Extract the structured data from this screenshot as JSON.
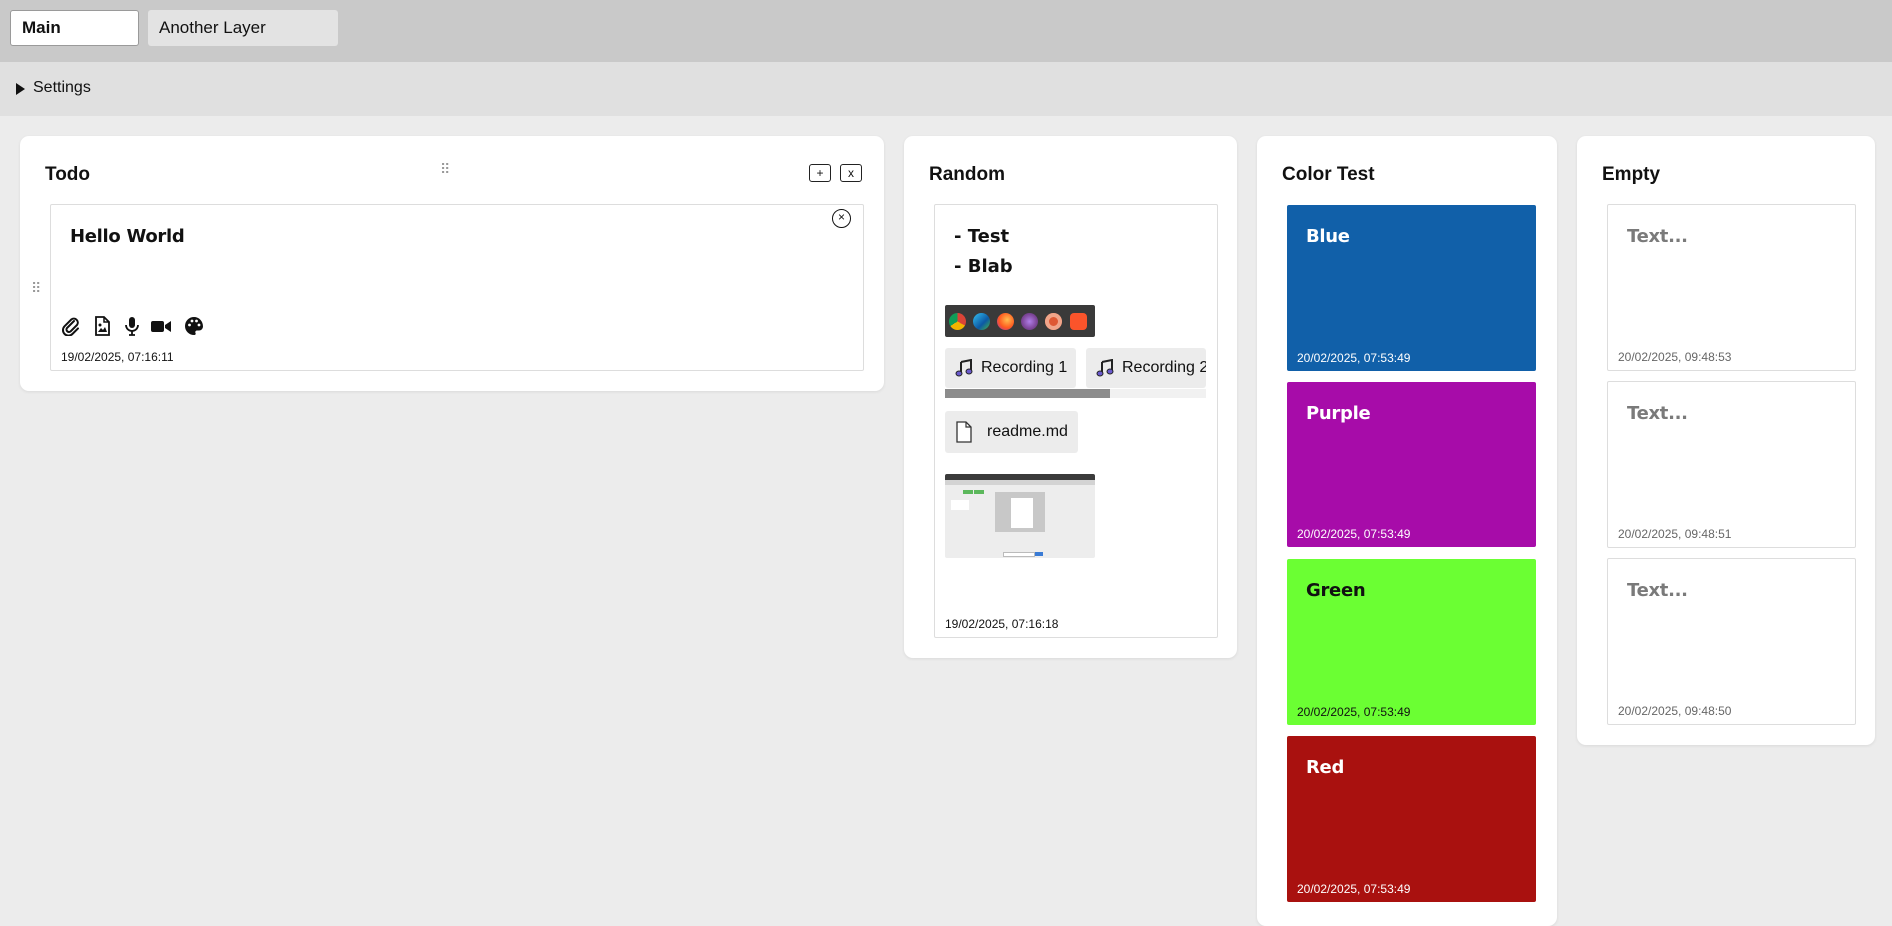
{
  "tabs": {
    "main": "Main",
    "another": "Another Layer"
  },
  "settings": {
    "label": "Settings"
  },
  "columns": {
    "todo": {
      "title": "Todo",
      "add_label": "+",
      "remove_label": "x",
      "note": {
        "title": "Hello World",
        "close_label": "×",
        "date": "19/02/2025, 07:16:11"
      }
    },
    "random": {
      "title": "Random",
      "note": {
        "lines": [
          "- Test",
          "- Blab"
        ],
        "recordings": [
          "Recording 1",
          "Recording 2"
        ],
        "file": "readme.md",
        "date": "19/02/2025, 07:16:18"
      }
    },
    "color_test": {
      "title": "Color Test",
      "notes": [
        {
          "title": "Blue",
          "date": "20/02/2025, 07:53:49",
          "color": "#1160a9"
        },
        {
          "title": "Purple",
          "date": "20/02/2025, 07:53:49",
          "color": "#a70ca9"
        },
        {
          "title": "Green",
          "date": "20/02/2025, 07:53:49",
          "color": "#6bff33"
        },
        {
          "title": "Red",
          "date": "20/02/2025, 07:53:49",
          "color": "#a9110f"
        }
      ]
    },
    "empty": {
      "title": "Empty",
      "notes": [
        {
          "title": "Text...",
          "date": "20/02/2025, 09:48:53"
        },
        {
          "title": "Text...",
          "date": "20/02/2025, 09:48:51"
        },
        {
          "title": "Text...",
          "date": "20/02/2025, 09:48:50"
        }
      ]
    }
  },
  "icons": {
    "toolbar": [
      "paperclip-icon",
      "image-file-icon",
      "microphone-icon",
      "video-camera-icon",
      "palette-icon"
    ],
    "recording": "music-note-icon",
    "file": "document-icon"
  }
}
